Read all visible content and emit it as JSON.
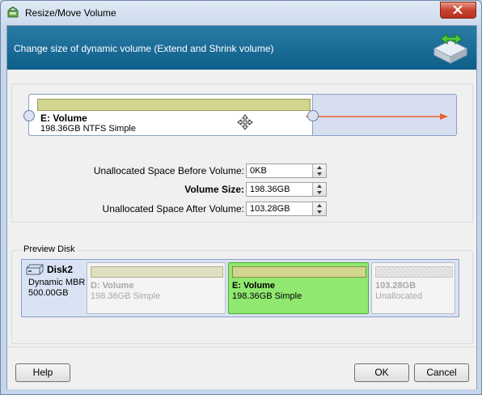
{
  "window": {
    "title": "Resize/Move Volume"
  },
  "header": {
    "text": "Change size of dynamic volume (Extend and Shrink volume)"
  },
  "partition": {
    "name": "E: Volume",
    "info": "198.36GB NTFS Simple"
  },
  "fields": {
    "before_label": "Unallocated Space Before Volume:",
    "before_value": "0KB",
    "size_label": "Volume Size:",
    "size_value": "198.36GB",
    "after_label": "Unallocated Space After Volume:",
    "after_value": "103.28GB"
  },
  "preview": {
    "label": "Preview Disk",
    "disk_name": "Disk2",
    "disk_type": "Dynamic MBR",
    "disk_size": "500.00GB",
    "volumes": [
      {
        "name": "D: Volume",
        "info": "198.36GB Simple"
      },
      {
        "name": "E: Volume",
        "info": "198.36GB Simple"
      },
      {
        "name": "103.28GB",
        "info": "Unallocated"
      }
    ]
  },
  "buttons": {
    "help": "Help",
    "ok": "OK",
    "cancel": "Cancel"
  },
  "colors": {
    "header_bg": "#1a6d98",
    "selected_volume": "#90e870",
    "partition_bar": "#d2d58e",
    "arrow": "#e8602c"
  }
}
